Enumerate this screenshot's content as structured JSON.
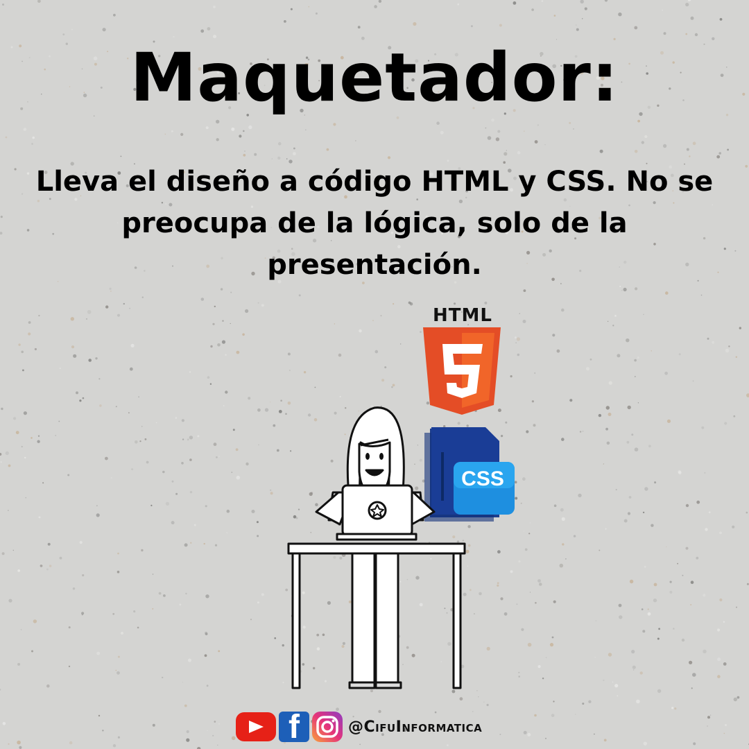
{
  "title": "Maquetador:",
  "description": "Lleva el diseño a código HTML y CSS. No se preocupa de la lógica, solo de la presentación.",
  "logos": {
    "html_label": "HTML",
    "html_number": "5",
    "css_label": "CSS",
    "html_color": "#e44d26",
    "css_color": "#1573c2"
  },
  "footer": {
    "icons": [
      "youtube-icon",
      "facebook-icon",
      "instagram-icon"
    ],
    "handle": "@CifuInformatica"
  },
  "colors": {
    "background": "#d4d4d2",
    "text": "#000000"
  }
}
